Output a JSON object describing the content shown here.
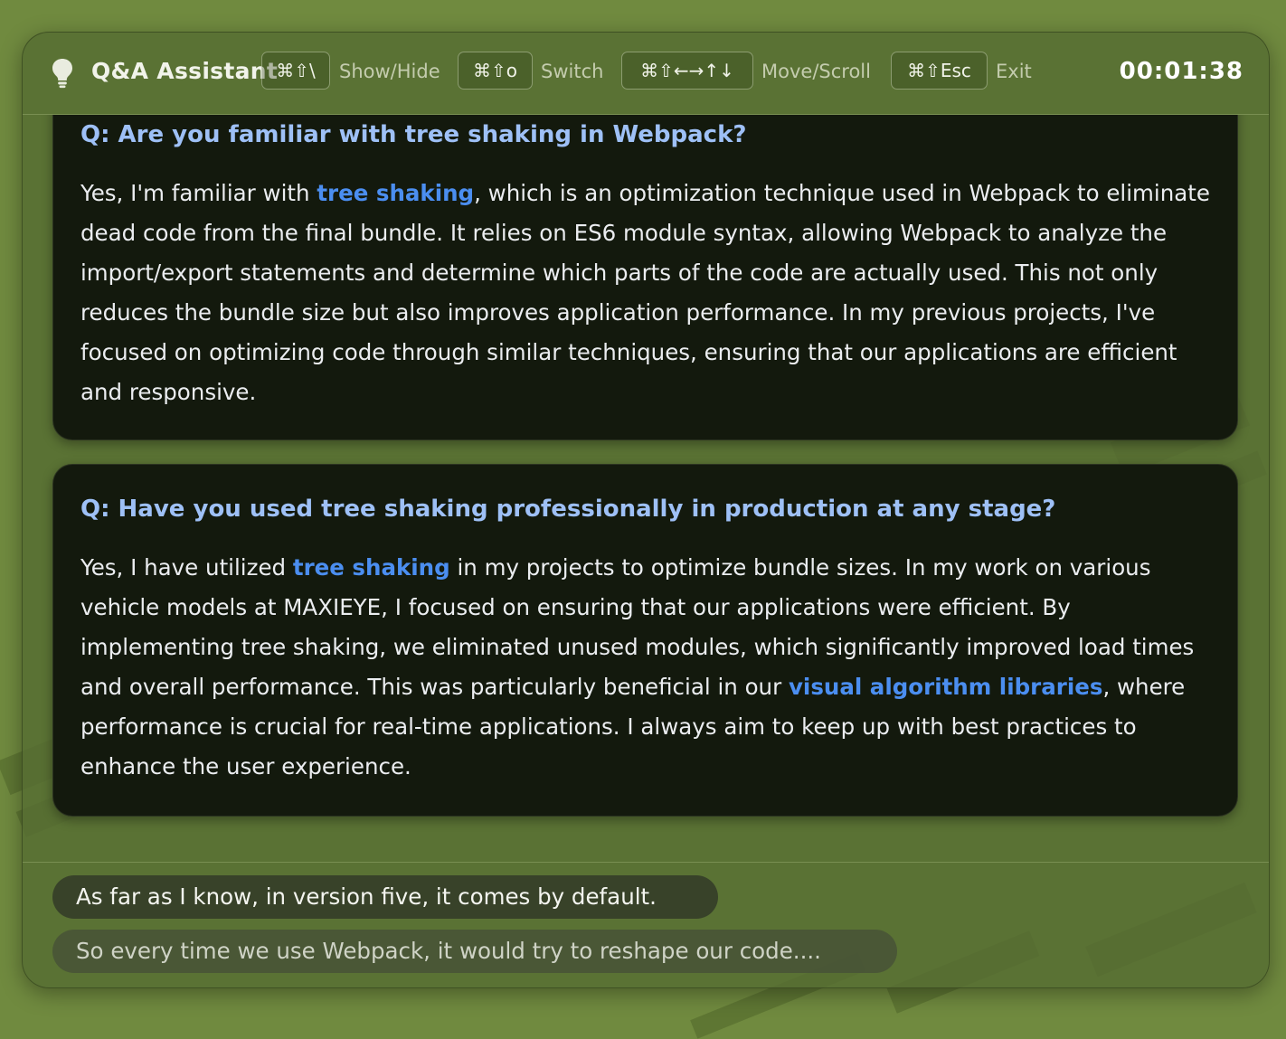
{
  "window": {
    "title": "Q&A Assistant",
    "timer": "00:01:38"
  },
  "shortcuts": [
    {
      "keys": "⌘⇧\\",
      "label": "Show/Hide"
    },
    {
      "keys": "⌘⇧o",
      "label": "Switch"
    },
    {
      "keys": "⌘⇧←→↑↓",
      "label": "Move/Scroll"
    },
    {
      "keys": "⌘⇧Esc",
      "label": "Exit"
    }
  ],
  "qa": [
    {
      "question": "Q: Are you familiar with tree shaking in Webpack?",
      "answer": {
        "p1": "Yes, I'm familiar with ",
        "h1": "tree shaking",
        "p2": ", which is an optimization technique used in Webpack to eliminate dead code from the final bundle. It relies on ES6 module syntax, allowing Webpack to analyze the import/export statements and determine which parts of the code are actually used. This not only reduces the bundle size but also improves application performance. In my previous projects, I've focused on optimizing code through similar techniques, ensuring that our applications are efficient and responsive."
      }
    },
    {
      "question": "Q: Have you used tree shaking professionally in production at any stage?",
      "answer": {
        "p1": "Yes, I have utilized ",
        "h1": "tree shaking",
        "p2": " in my projects to optimize bundle sizes. In my work on various vehicle models at MAXIEYE, I focused on ensuring that our applications were efficient. By implementing tree shaking, we eliminated unused modules, which significantly improved load times and overall performance. This was particularly beneficial in our ",
        "h2": "visual algorithm libraries",
        "p3": ", where performance is crucial for real-time applications. I always aim to keep up with best practices to enhance the user experience."
      }
    }
  ],
  "transcript": {
    "final": "As far as I know, in version five, it comes by default.",
    "interim": "So every time we use Webpack, it would try to reshape our code...."
  },
  "colors": {
    "background": "#708a3f",
    "question": "#9ec0f6",
    "highlight": "#4b8ef0",
    "card": "#0e120b"
  },
  "icons": {
    "app": "lightbulb-icon"
  }
}
